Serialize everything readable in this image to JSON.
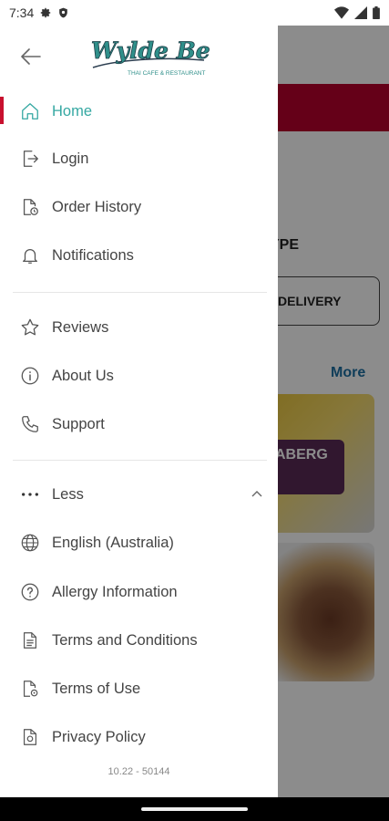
{
  "status_bar": {
    "time": "7:34"
  },
  "background": {
    "order_type_label": "YPE",
    "delivery_label": "DELIVERY",
    "more_label": "More",
    "card1_text": "ABERG"
  },
  "drawer": {
    "brand": {
      "name": "Wylde Bean",
      "tagline": "THAI CAFE & RESTAURANT"
    },
    "primary_items": [
      {
        "label": "Home",
        "icon": "home-icon",
        "active": true
      },
      {
        "label": "Login",
        "icon": "login-icon"
      },
      {
        "label": "Order History",
        "icon": "order-history-icon"
      },
      {
        "label": "Notifications",
        "icon": "bell-icon"
      }
    ],
    "secondary_items": [
      {
        "label": "Reviews",
        "icon": "star-icon"
      },
      {
        "label": "About Us",
        "icon": "info-icon"
      },
      {
        "label": "Support",
        "icon": "phone-icon"
      }
    ],
    "more_toggle": {
      "label": "Less",
      "icon": "more-dots-icon",
      "expanded": true
    },
    "extra_items": [
      {
        "label": "English (Australia)",
        "icon": "globe-icon"
      },
      {
        "label": "Allergy Information",
        "icon": "question-icon"
      },
      {
        "label": "Terms and Conditions",
        "icon": "document-icon"
      },
      {
        "label": "Terms of Use",
        "icon": "document-settings-icon"
      },
      {
        "label": "Privacy Policy",
        "icon": "privacy-icon"
      }
    ],
    "version": "10.22 - 50144"
  },
  "colors": {
    "accent": "#35a8a2",
    "active_bar": "#c8102e",
    "brand_red": "#b8002c",
    "link_blue": "#1d6fa3"
  }
}
